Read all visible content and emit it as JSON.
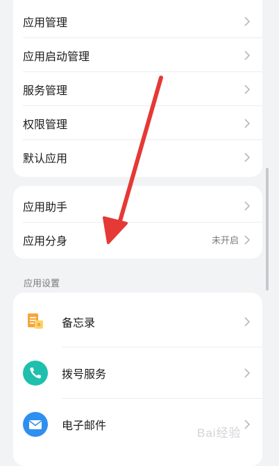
{
  "group1": {
    "items": [
      {
        "label": "应用管理"
      },
      {
        "label": "应用启动管理"
      },
      {
        "label": "服务管理"
      },
      {
        "label": "权限管理"
      },
      {
        "label": "默认应用"
      }
    ]
  },
  "group2": {
    "items": [
      {
        "label": "应用助手",
        "value": ""
      },
      {
        "label": "应用分身",
        "value": "未开启"
      }
    ]
  },
  "section": {
    "title": "应用设置"
  },
  "apps": {
    "items": [
      {
        "label": "备忘录",
        "icon": "notepad-icon"
      },
      {
        "label": "拨号服务",
        "icon": "phone-icon"
      },
      {
        "label": "电子邮件",
        "icon": "email-icon"
      }
    ]
  },
  "colors": {
    "arrow": "#e53935",
    "notepad": "#f7a43a",
    "phone": "#1fbfae",
    "email": "#2f8ff0"
  },
  "watermark": {
    "text": "Bai经验"
  }
}
